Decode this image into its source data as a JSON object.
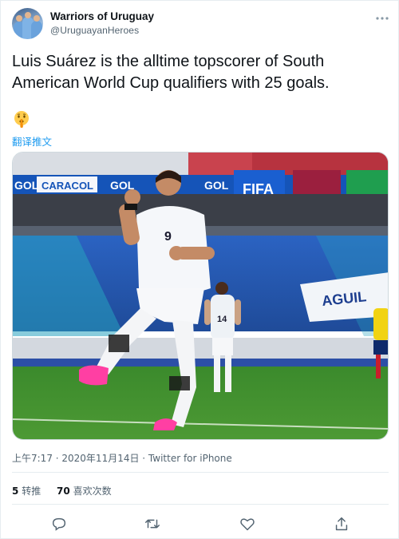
{
  "account": {
    "name": "Warriors of Uruguay",
    "handle": "@UruguayanHeroes"
  },
  "tweet": {
    "text": "Luis Suárez is the alltime topscorer of South American World Cup qualifiers with 25 goals.",
    "emoji": "shushing-face",
    "translate_label": "翻译推文",
    "timestamp": "上午7:17 · 2020年11月14日 · Twitter for iPhone"
  },
  "media": {
    "board_text": [
      "GOL",
      "CARACOL",
      "GOL",
      "GOL",
      "FIFA",
      "AGUIL"
    ],
    "jersey_numbers": [
      "9",
      "14"
    ]
  },
  "stats": {
    "retweets_count": "5",
    "retweets_label": "转推",
    "likes_count": "70",
    "likes_label": "喜欢次数"
  },
  "icons": {
    "reply": "reply-icon",
    "retweet": "retweet-icon",
    "like": "like-icon",
    "share": "share-icon",
    "more": "more-icon"
  },
  "colors": {
    "link": "#1d9bf0",
    "secondary_text": "#536471",
    "pitch": "#3f8a2b",
    "stands": "#2c5fb8",
    "jersey": "#f5f7fa"
  }
}
